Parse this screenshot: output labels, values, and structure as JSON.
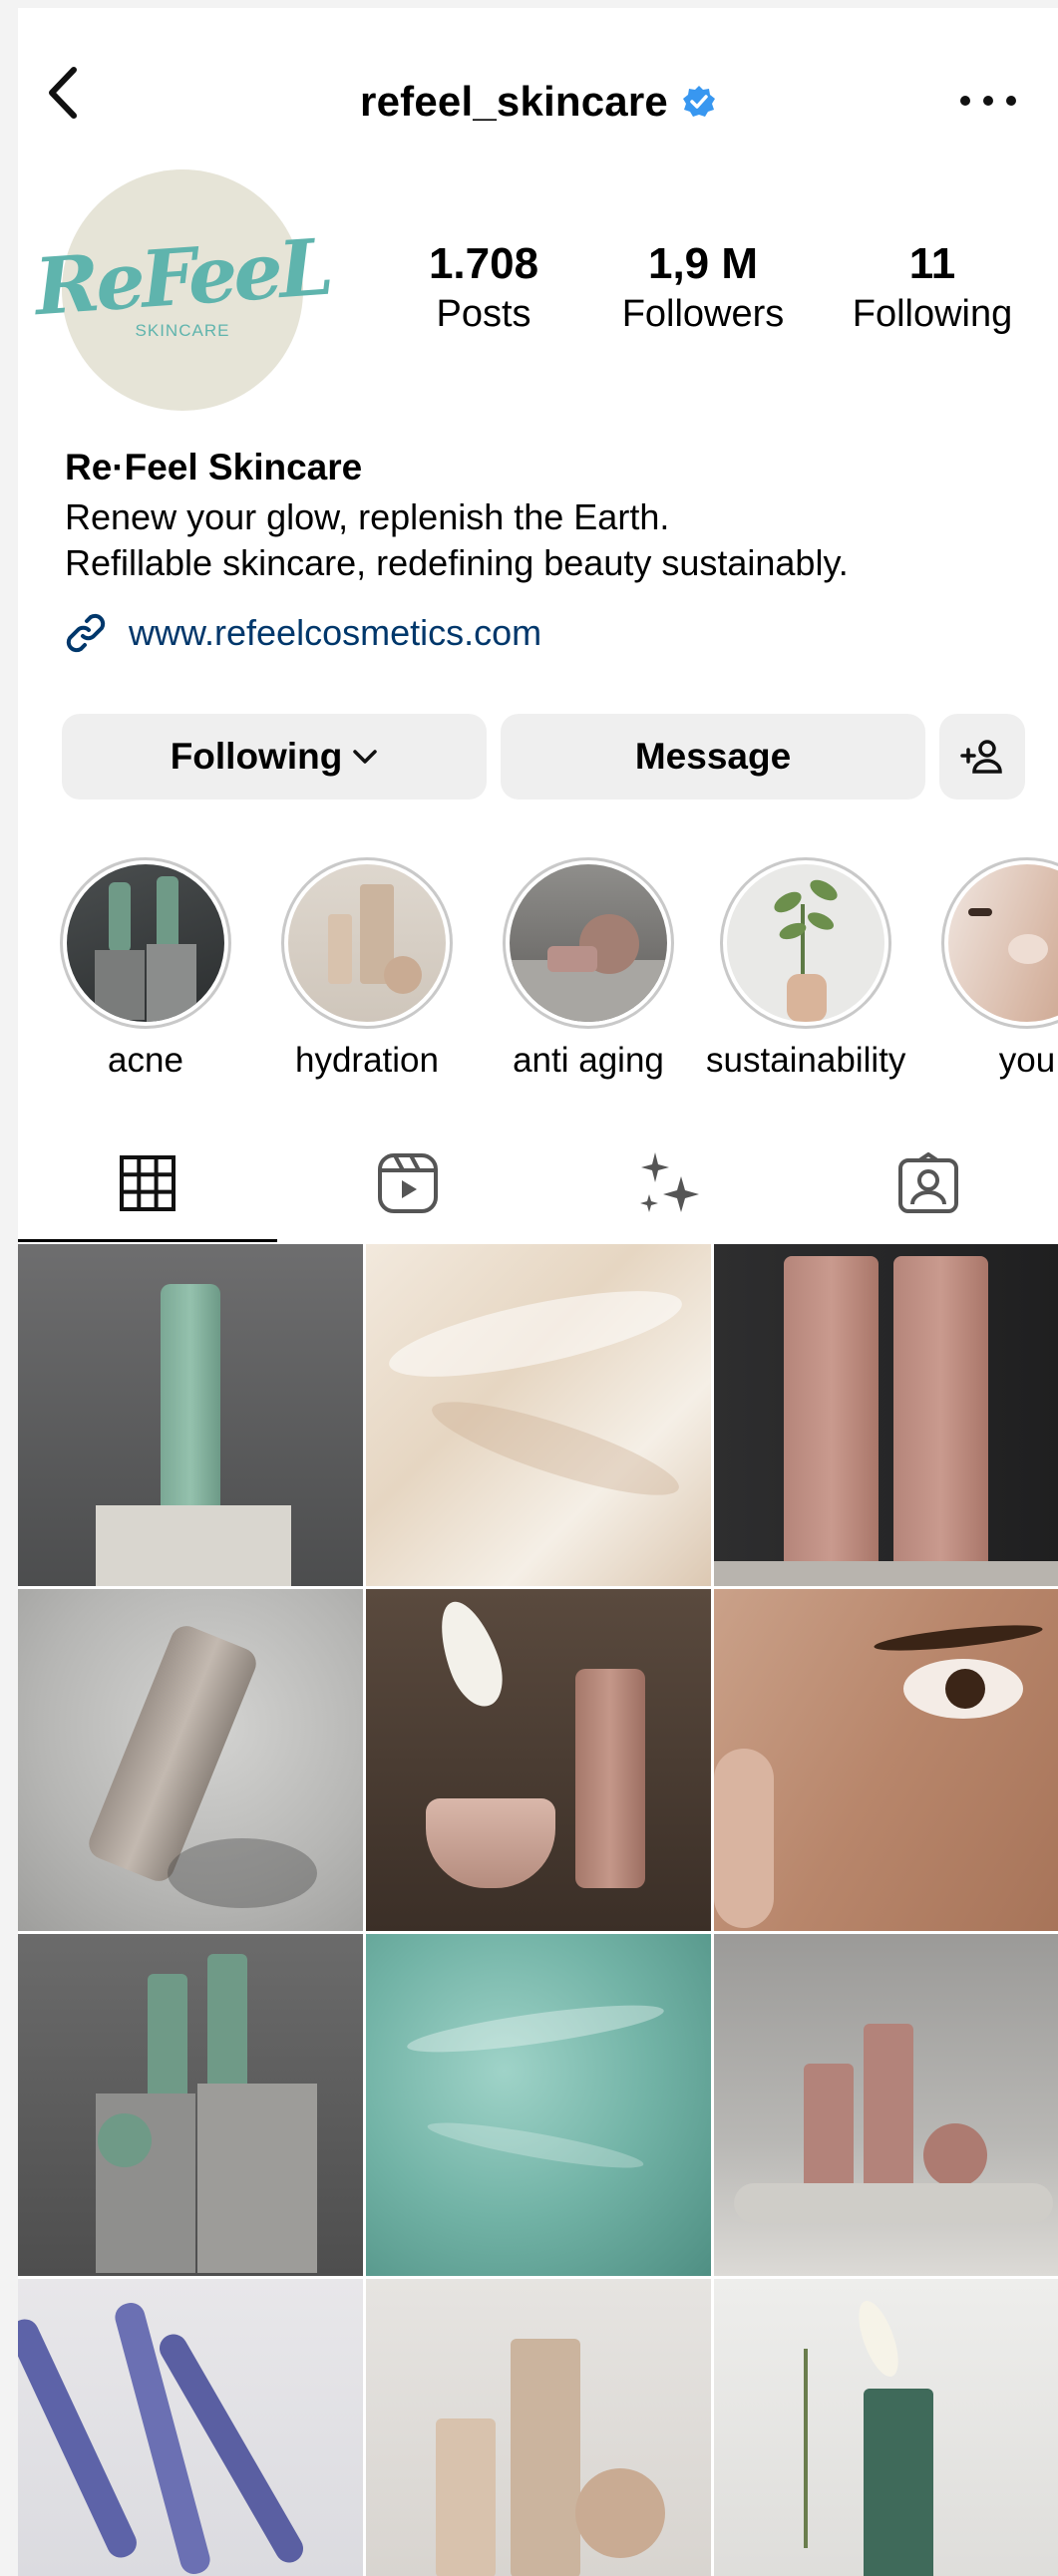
{
  "header": {
    "username": "refeel_skincare",
    "verified": true
  },
  "profile": {
    "avatar_logo": "ReFeeL",
    "avatar_subtext": "SKINCARE",
    "stats": {
      "posts_count": "1.708",
      "posts_label": "Posts",
      "followers_count": "1,9 M",
      "followers_label": "Followers",
      "following_count": "11",
      "following_label": "Following"
    },
    "bio": {
      "name": "Re·Feel Skincare",
      "line1": "Renew your glow, replenish the Earth.",
      "line2": "Refillable skincare, redefining beauty sustainably.",
      "link": "www.refeelcosmetics.com"
    }
  },
  "actions": {
    "following_label": "Following",
    "message_label": "Message"
  },
  "highlights": [
    {
      "label": "acne"
    },
    {
      "label": "hydration"
    },
    {
      "label": "anti aging"
    },
    {
      "label": "sustainability"
    },
    {
      "label": "you"
    }
  ],
  "tabs": [
    "grid-icon",
    "reels-icon",
    "sparkle-icon",
    "tagged-icon"
  ],
  "colors": {
    "verified_blue": "#3897f0",
    "link_blue": "#00376b",
    "button_bg": "#efefef",
    "brand_teal": "#5fb4ad"
  },
  "grid_posts": [
    "Green bottle on stone block",
    "Cream texture",
    "Two pink bottles",
    "Bottle in water",
    "Jar and pump bottle with flower",
    "Close-up of eye and skin",
    "Green bottles on rocks",
    "Teal water surface",
    "Pink bottles on tray",
    "Lavender flowers",
    "Beige products",
    "Lily with green bottle"
  ]
}
